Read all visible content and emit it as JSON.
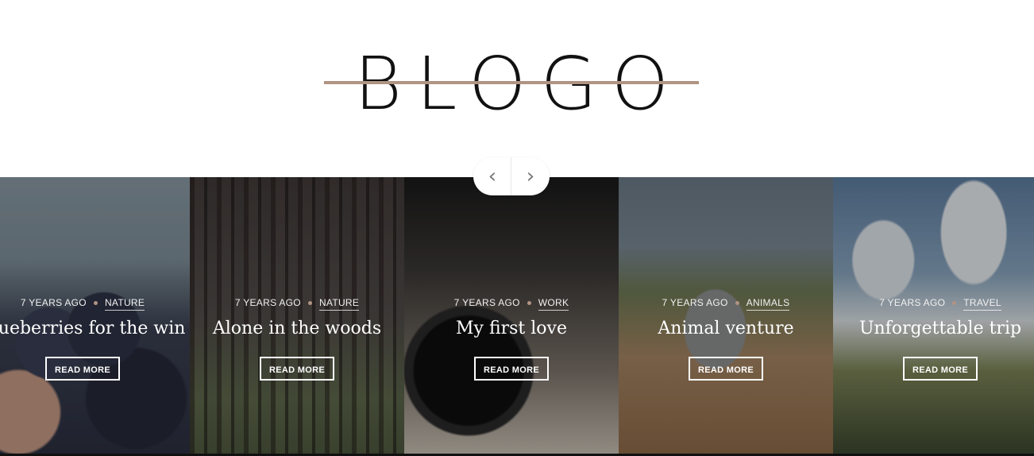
{
  "site": {
    "logo_text": "BLOGO",
    "accent_color": "#b09483"
  },
  "slider": {
    "prev_icon": "chevron-left-icon",
    "next_icon": "chevron-right-icon",
    "prev_glyph": "‹",
    "next_glyph": "›",
    "slides": [
      {
        "time": "7 YEARS AGO",
        "category": "NATURE",
        "title": "Blueberries for the win",
        "button": "READ MORE"
      },
      {
        "time": "7 YEARS AGO",
        "category": "NATURE",
        "title": "Alone in the woods",
        "button": "READ MORE"
      },
      {
        "time": "7 YEARS AGO",
        "category": "WORK",
        "title": "My first love",
        "button": "READ MORE"
      },
      {
        "time": "7 YEARS AGO",
        "category": "ANIMALS",
        "title": "Animal venture",
        "button": "READ MORE"
      },
      {
        "time": "7 YEARS AGO",
        "category": "TRAVEL",
        "title": "Unforgettable trip",
        "button": "READ MORE"
      }
    ]
  }
}
